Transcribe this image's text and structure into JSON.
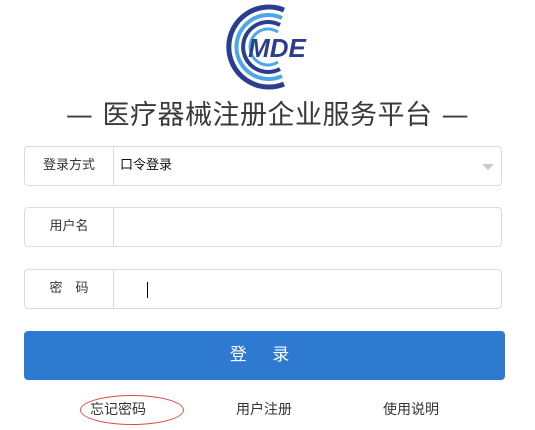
{
  "logo": {
    "text": "MDE",
    "icon": "mde-logo-icon",
    "colors": {
      "dark_blue": "#2a3d8f",
      "light_blue": "#4aa8e6"
    }
  },
  "title": {
    "text": "— 医疗器械注册企业服务平台 —"
  },
  "form": {
    "login_method": {
      "label": "登录方式",
      "selected_value": "口令登录"
    },
    "username": {
      "label": "用户名",
      "value": ""
    },
    "password": {
      "label": "密　码",
      "value": ""
    }
  },
  "buttons": {
    "login_label": "登 录"
  },
  "links": {
    "forgot_password": "忘记密码",
    "register": "用户注册",
    "instructions": "使用说明"
  },
  "colors": {
    "accent": "#2e7ad1",
    "highlight_circle": "#e04848"
  }
}
